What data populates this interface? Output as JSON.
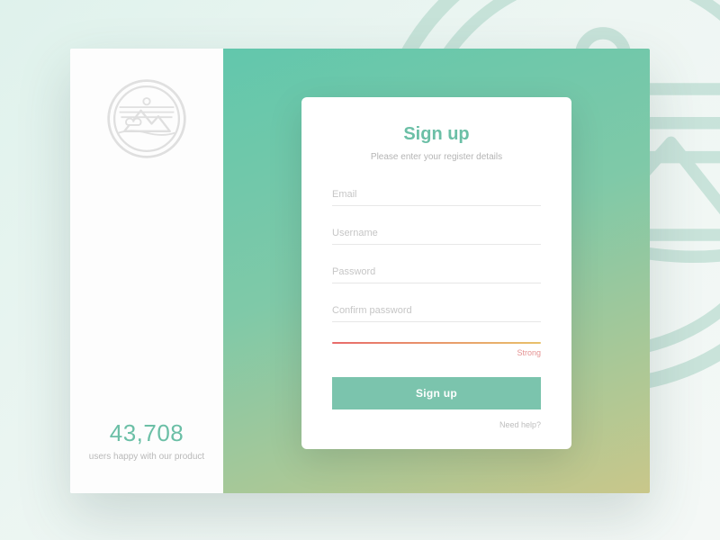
{
  "sidebar": {
    "user_count": "43,708",
    "user_caption": "users happy with our product"
  },
  "form": {
    "title": "Sign up",
    "subtitle": "Please enter your register details",
    "email_placeholder": "Email",
    "username_placeholder": "Username",
    "password_placeholder": "Password",
    "confirm_placeholder": "Confirm password",
    "strength_label": "Strong",
    "submit_label": "Sign up",
    "help_label": "Need help?"
  },
  "colors": {
    "accent": "#6bbfa6",
    "button": "#7bc4ad",
    "strength_color": "#e59393"
  }
}
